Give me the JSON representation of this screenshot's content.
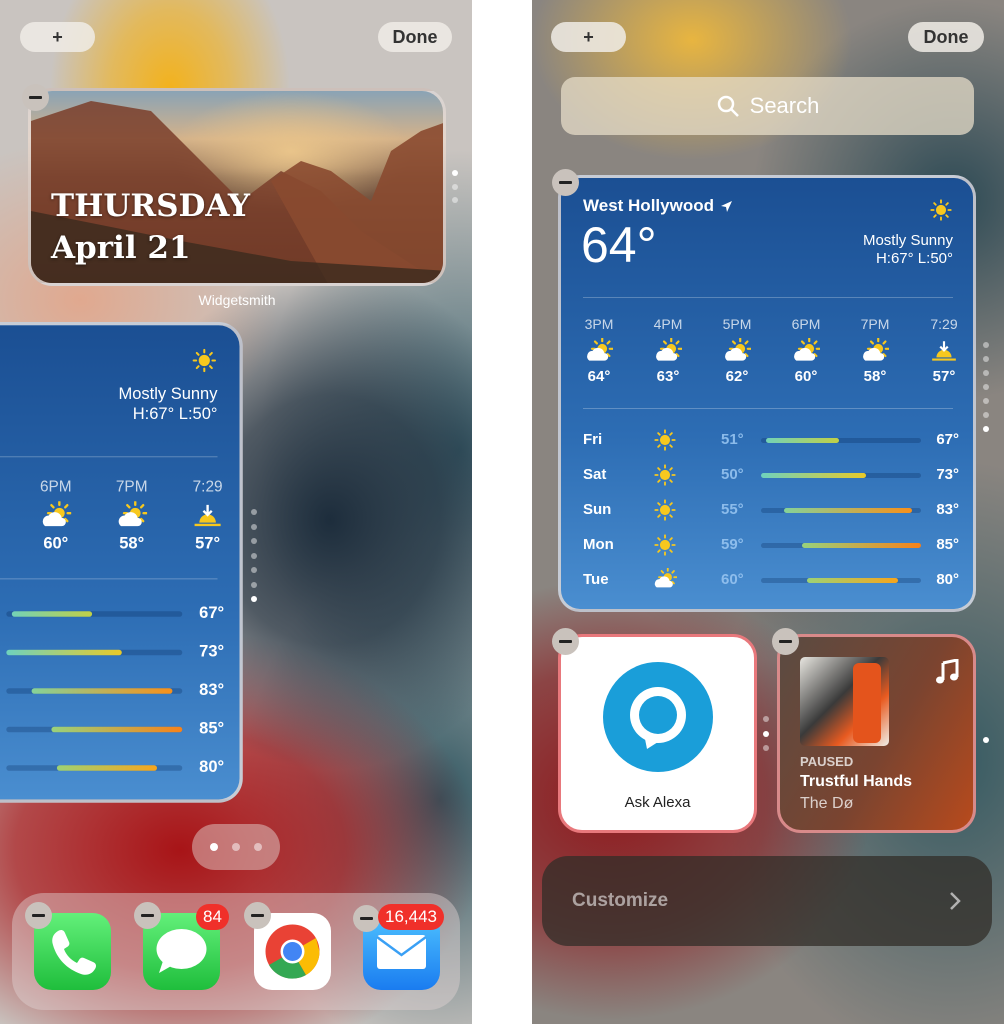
{
  "top": {
    "add_label": "+",
    "done_label": "Done"
  },
  "widgetsmith": {
    "day": "THURSDAY",
    "date": "April 21",
    "label": "Widgetsmith"
  },
  "search": {
    "placeholder": "Search"
  },
  "weather": {
    "city": "West Hollywood",
    "current_temp": "64°",
    "condition": "Mostly Sunny",
    "high_low": "H:67° L:50°",
    "hourly": [
      {
        "time": "3PM",
        "icon": "partly-cloudy",
        "temp": "64°"
      },
      {
        "time": "4PM",
        "icon": "partly-cloudy",
        "temp": "63°"
      },
      {
        "time": "5PM",
        "icon": "partly-cloudy",
        "temp": "62°"
      },
      {
        "time": "6PM",
        "icon": "partly-cloudy",
        "temp": "60°"
      },
      {
        "time": "7PM",
        "icon": "partly-cloudy",
        "temp": "58°"
      },
      {
        "time": "7:29",
        "icon": "sunset",
        "temp": "57°"
      }
    ],
    "daily": [
      {
        "day": "Fri",
        "icon": "sun",
        "low": "51°",
        "high": "67°",
        "low_v": 51,
        "high_v": 67
      },
      {
        "day": "Sat",
        "icon": "sun",
        "low": "50°",
        "high": "73°",
        "low_v": 50,
        "high_v": 73
      },
      {
        "day": "Sun",
        "icon": "sun",
        "low": "55°",
        "high": "83°",
        "low_v": 55,
        "high_v": 83
      },
      {
        "day": "Mon",
        "icon": "sun",
        "low": "59°",
        "high": "85°",
        "low_v": 59,
        "high_v": 85
      },
      {
        "day": "Tue",
        "icon": "partly-cloudy",
        "low": "60°",
        "high": "80°",
        "low_v": 60,
        "high_v": 80
      }
    ],
    "range": [
      50,
      85
    ]
  },
  "alexa": {
    "label": "Ask Alexa",
    "brand_color": "#1a9ed9"
  },
  "music": {
    "status": "PAUSED",
    "title": "Trustful Hands",
    "artist": "The Dø"
  },
  "customize": {
    "label": "Customize"
  },
  "dock": [
    {
      "name": "Phone",
      "badge": null
    },
    {
      "name": "Messages",
      "badge": "84"
    },
    {
      "name": "Chrome",
      "badge": null
    },
    {
      "name": "Mail",
      "badge": "16,443"
    }
  ],
  "pages": {
    "current": 1,
    "total": 3
  }
}
